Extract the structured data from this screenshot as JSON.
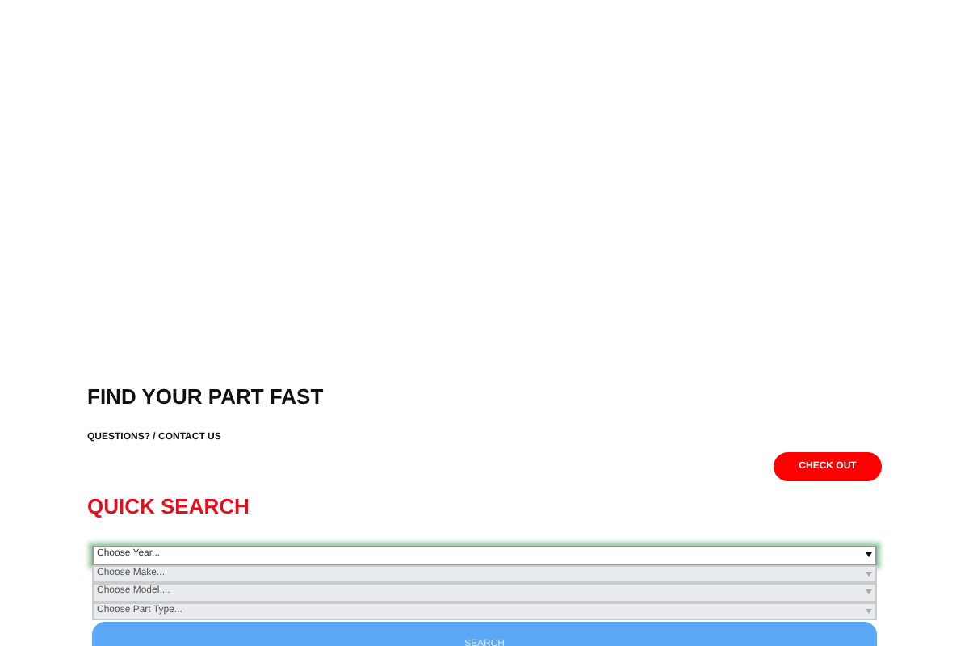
{
  "heading": "FIND YOUR PART FAST",
  "contact_link": "QUESTIONS? / CONTACT US",
  "checkout_button": "CHECK OUT",
  "quick_search": {
    "title": "QUICK SEARCH",
    "selects": [
      {
        "placeholder": "Choose Year...",
        "disabled": false,
        "focused": true
      },
      {
        "placeholder": "Choose Make...",
        "disabled": true,
        "focused": false
      },
      {
        "placeholder": "Choose Model....",
        "disabled": true,
        "focused": false
      },
      {
        "placeholder": "Choose Part Type...",
        "disabled": true,
        "focused": false
      }
    ],
    "search_button": "SEARCH"
  }
}
